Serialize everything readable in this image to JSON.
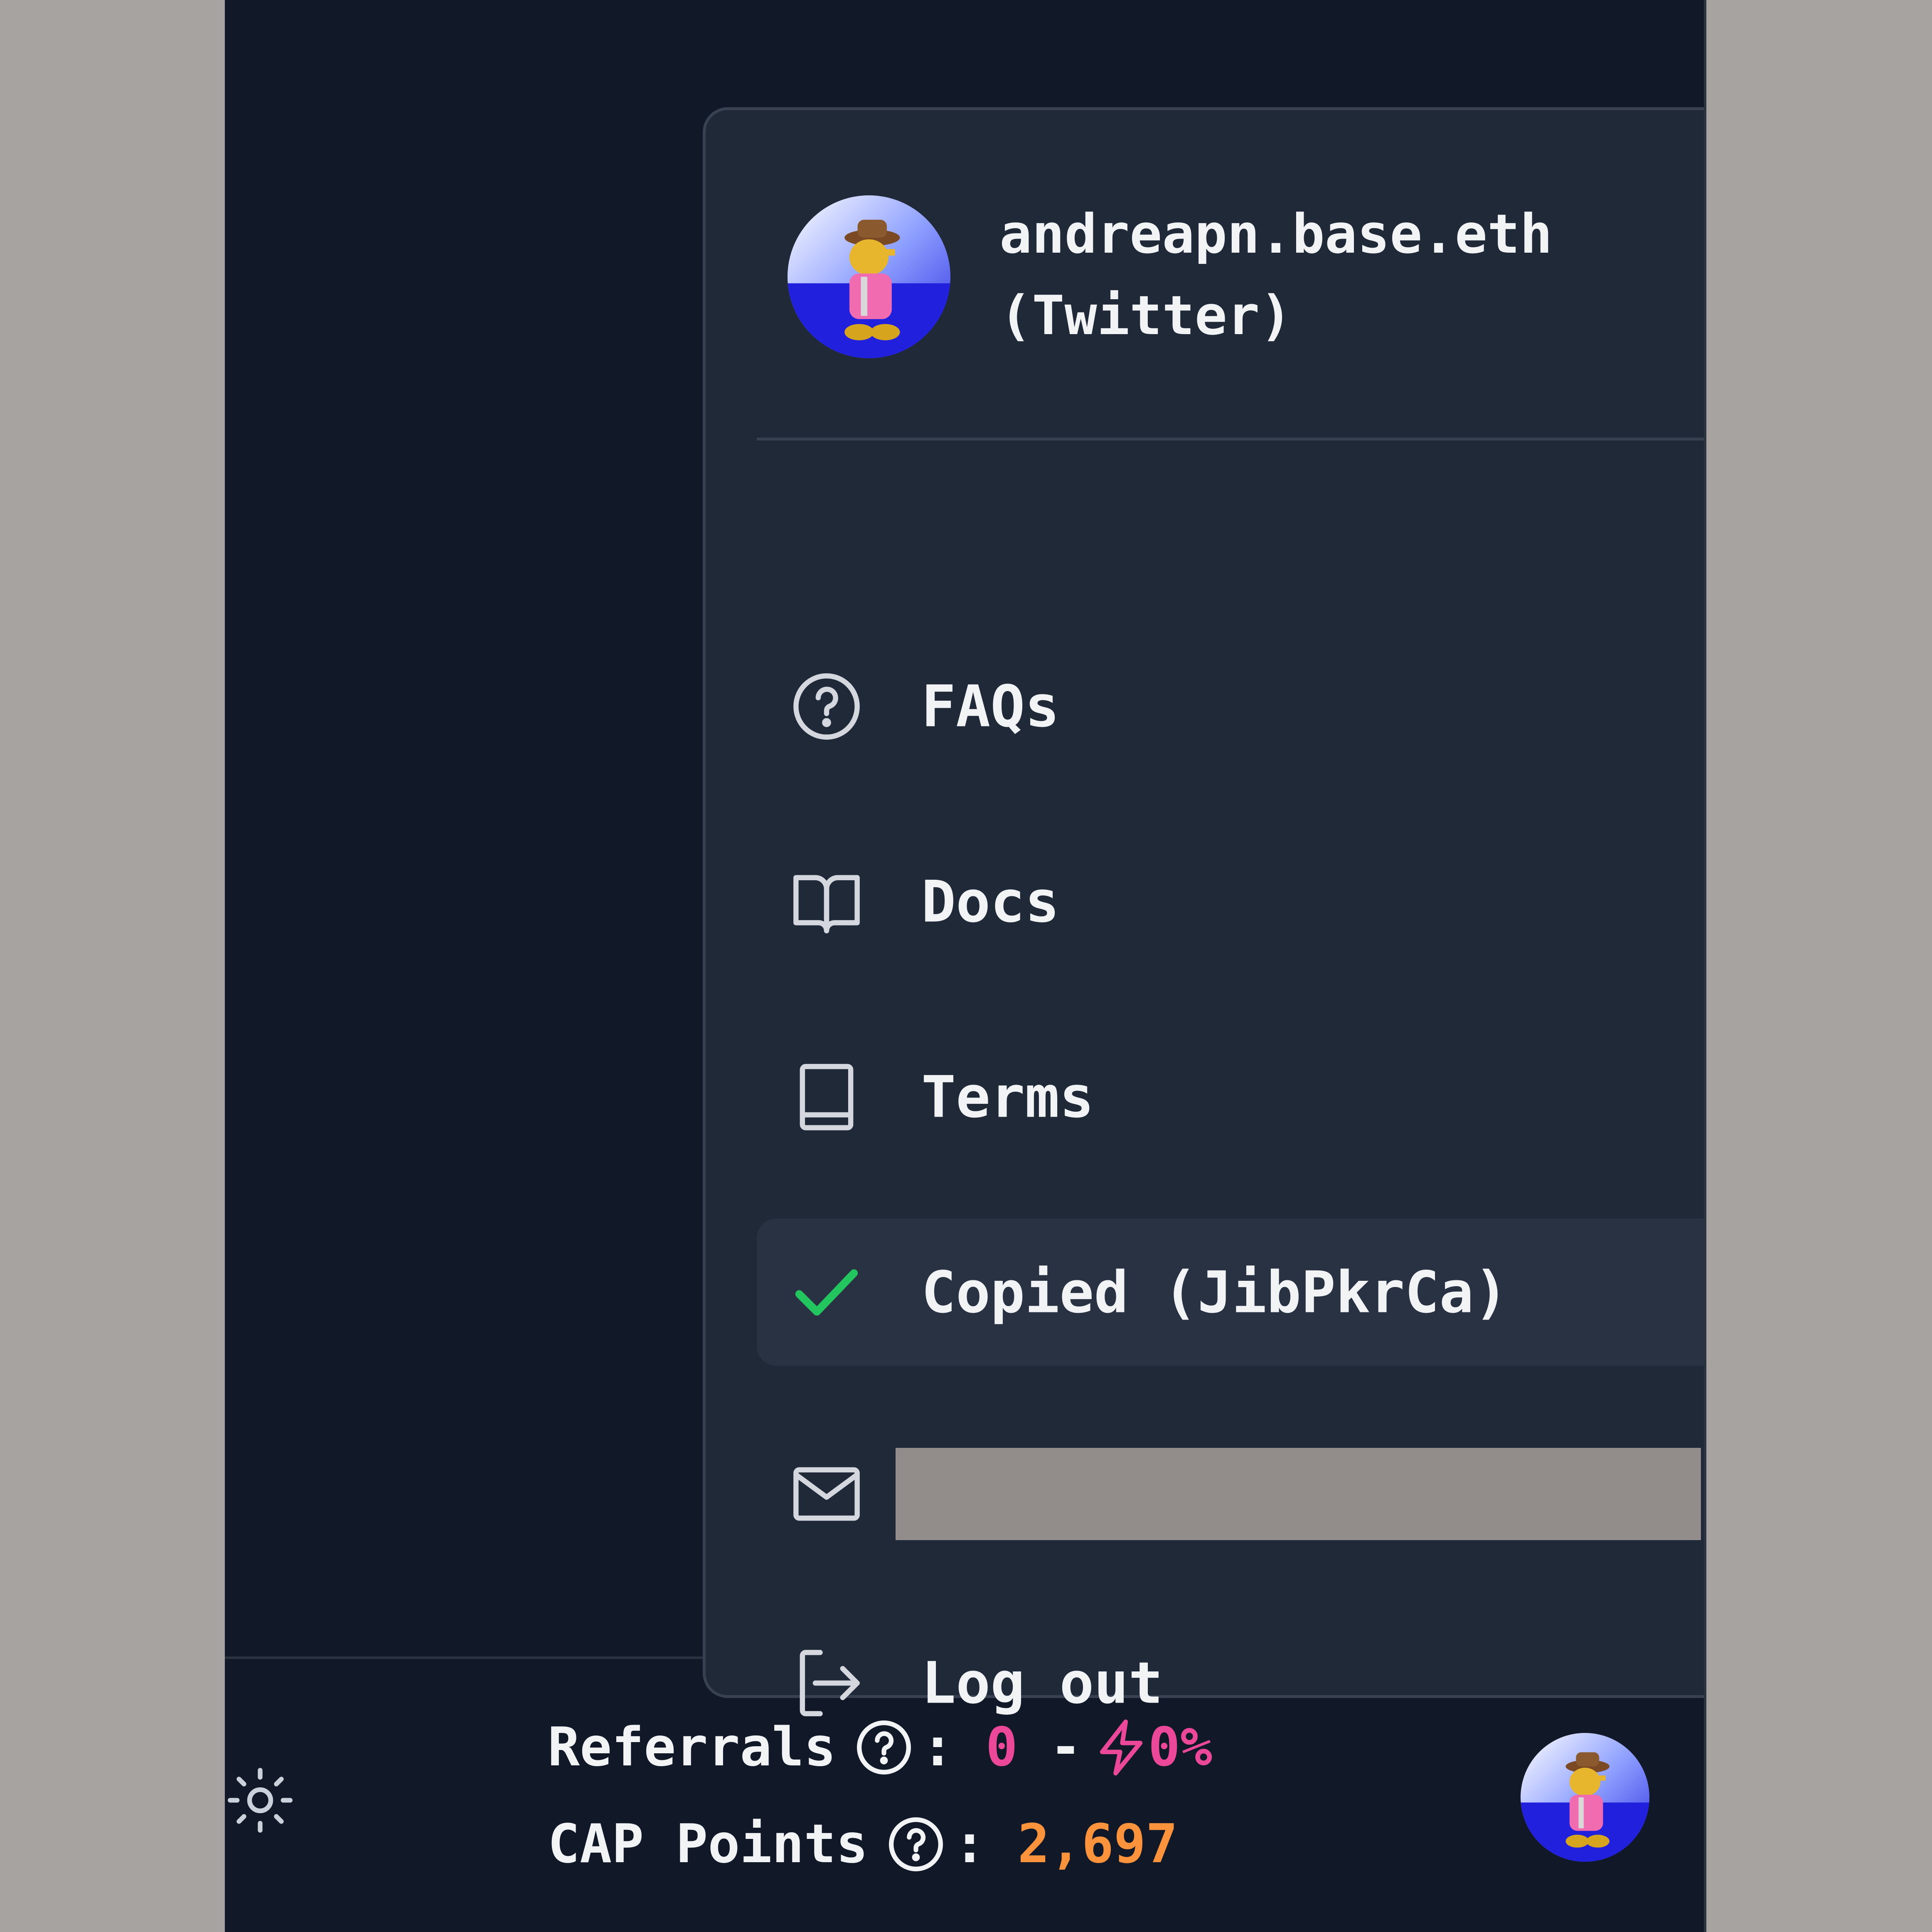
{
  "account_menu": {
    "profile": {
      "name_line1": "andreapn.base.eth",
      "name_line2": "(Twitter)",
      "avatar_icon": "pixel-art-avatar"
    },
    "items": [
      {
        "label": "FAQs",
        "icon": "question-circle-icon"
      },
      {
        "label": "Docs",
        "icon": "open-book-icon"
      },
      {
        "label": "Terms",
        "icon": "book-icon"
      },
      {
        "label": "Copied (JibPkrCa)",
        "icon": "check-icon",
        "active": true
      },
      {
        "label": "",
        "icon": "mail-icon",
        "redacted": true
      },
      {
        "label": "Log out",
        "icon": "logout-icon"
      }
    ]
  },
  "footer": {
    "referrals": {
      "label": "Referrals",
      "count": "0",
      "separator": "-",
      "boost": "0%"
    },
    "cap_points": {
      "label": "CAP Points",
      "value": "2,697"
    },
    "theme_icon": "sun-icon"
  },
  "colors": {
    "background": "#111827",
    "menu_bg": "#1f2937",
    "pink": "#ec4899",
    "orange": "#fb923c",
    "check_green": "#22c55e"
  }
}
